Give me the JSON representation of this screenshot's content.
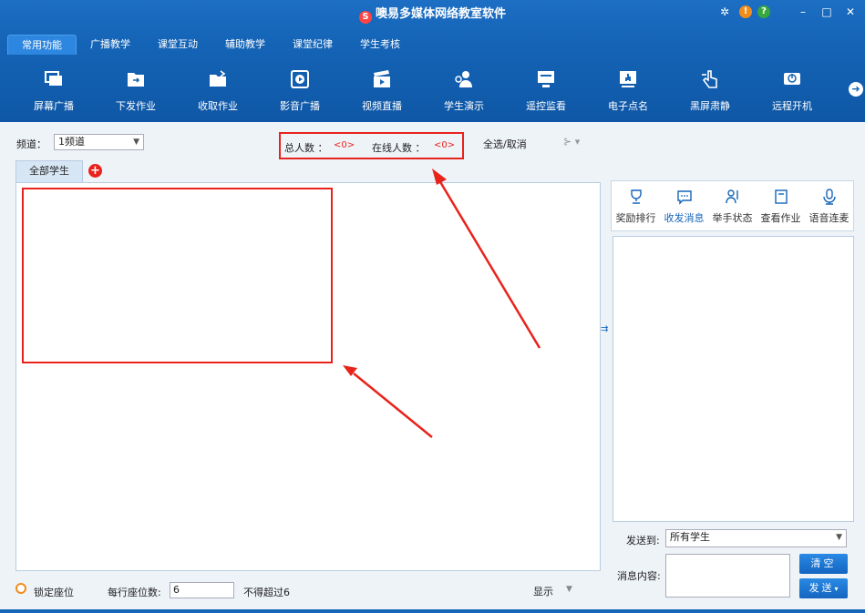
{
  "app": {
    "title": "噢易多媒体网络教室软件",
    "logo_glyph": "S"
  },
  "window_controls": {
    "settings": "✲",
    "info": "!",
    "help": "?",
    "minimize": "–",
    "maximize": "□",
    "close": "✕"
  },
  "menu_tabs": [
    {
      "label": "常用功能",
      "active": true
    },
    {
      "label": "广播教学",
      "active": false
    },
    {
      "label": "课堂互动",
      "active": false
    },
    {
      "label": "辅助教学",
      "active": false
    },
    {
      "label": "课堂纪律",
      "active": false
    },
    {
      "label": "学生考核",
      "active": false
    }
  ],
  "toolbar": {
    "items": [
      {
        "label": "屏幕广播",
        "icon": "screen-broadcast-icon"
      },
      {
        "label": "下发作业",
        "icon": "send-homework-icon"
      },
      {
        "label": "收取作业",
        "icon": "collect-homework-icon"
      },
      {
        "label": "影音广播",
        "icon": "media-broadcast-icon"
      },
      {
        "label": "视频直播",
        "icon": "video-live-icon"
      },
      {
        "label": "学生演示",
        "icon": "student-demo-icon"
      },
      {
        "label": "遥控监看",
        "icon": "remote-monitor-icon"
      },
      {
        "label": "电子点名",
        "icon": "roll-call-icon"
      },
      {
        "label": "黑屏肃静",
        "icon": "black-screen-icon"
      },
      {
        "label": "远程开机",
        "icon": "remote-power-icon"
      }
    ],
    "more_glyph": "➜"
  },
  "filter": {
    "channel_label": "频道：",
    "channel_value": "1频道",
    "total_label": "总人数 ：",
    "total_value": "<0>",
    "online_label": "在线人数 ：",
    "online_value": "<0>",
    "select_all": "全选/取消"
  },
  "seat_tabs": {
    "all_students": "全部学生",
    "add_glyph": "+"
  },
  "right_panel": {
    "tools": [
      {
        "label": "奖励排行",
        "icon": "trophy-icon",
        "active": false
      },
      {
        "label": "收发消息",
        "icon": "message-icon",
        "active": true
      },
      {
        "label": "举手状态",
        "icon": "raise-hand-icon",
        "active": false
      },
      {
        "label": "查看作业",
        "icon": "homework-icon",
        "active": false
      },
      {
        "label": "语音连麦",
        "icon": "microphone-icon",
        "active": false
      }
    ],
    "send_to_label": "发送到:",
    "send_to_value": "所有学生",
    "message_label": "消息内容:",
    "clear_button": "清空",
    "send_button": "发送"
  },
  "bottom": {
    "lock_seat_label": "锁定座位",
    "per_row_label": "每行座位数:",
    "per_row_value": "6",
    "limit_label": "不得超过6",
    "display_label": "显示"
  }
}
